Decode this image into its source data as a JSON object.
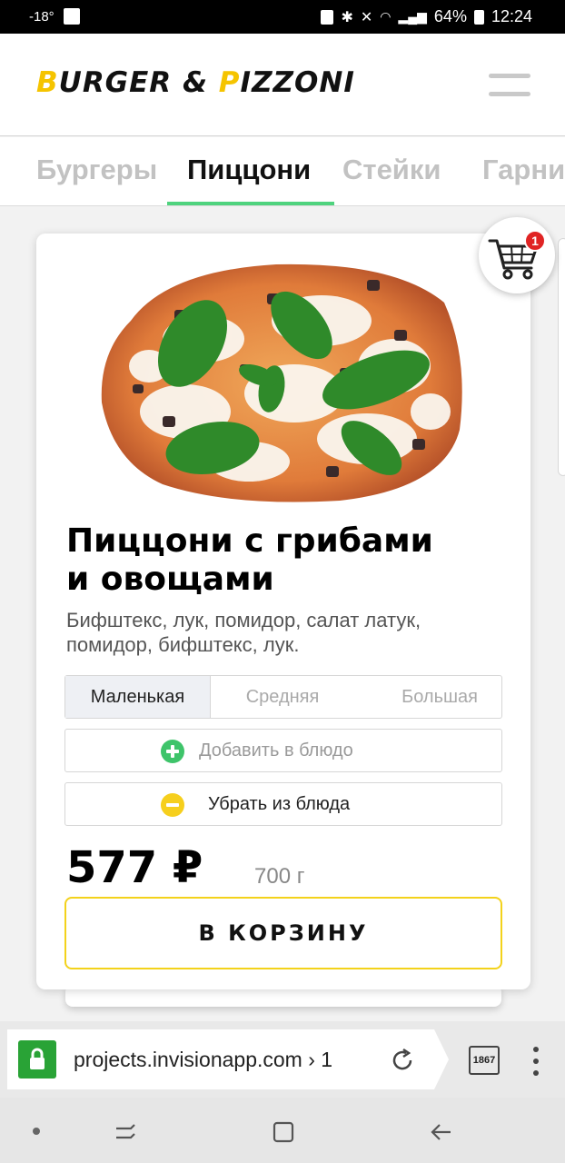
{
  "status_bar": {
    "temperature": "-18°",
    "battery": "64%",
    "time": "12:24"
  },
  "header": {
    "logo_part1_accent": "B",
    "logo_part1_rest": "URGER & ",
    "logo_part2_accent": "P",
    "logo_part2_rest": "IZZONI"
  },
  "tabs": [
    {
      "label": "Бургеры",
      "active": false
    },
    {
      "label": "Пиццони",
      "active": true
    },
    {
      "label": "Стейки",
      "active": false
    },
    {
      "label": "Гарни",
      "active": false
    }
  ],
  "cart": {
    "badge_count": "1"
  },
  "product": {
    "title_line1": "Пиццони с грибами",
    "title_line2": "и овощами",
    "description_line1": "Бифштекс, лук, помидор, салат латук,",
    "description_line2": "помидор, бифштекс, лук.",
    "sizes": [
      {
        "label": "Маленькая",
        "selected": true
      },
      {
        "label": "Средняя",
        "selected": false
      },
      {
        "label": "Большая",
        "selected": false
      }
    ],
    "add_label": "Добавить в  блюдо",
    "remove_label": "Убрать из блюда",
    "price": "577 ₽",
    "weight": "700 г",
    "cart_button_label": "В КОРЗИНУ"
  },
  "browser": {
    "url": "projects.invisionapp.com › 1",
    "tab_count": "1867"
  },
  "colors": {
    "accent_yellow": "#f5c400",
    "tab_underline": "#4fd37e",
    "add_green": "#3ec46a",
    "remove_yellow": "#f6cf1d",
    "badge_red": "#e02424",
    "lock_green": "#29a336"
  }
}
